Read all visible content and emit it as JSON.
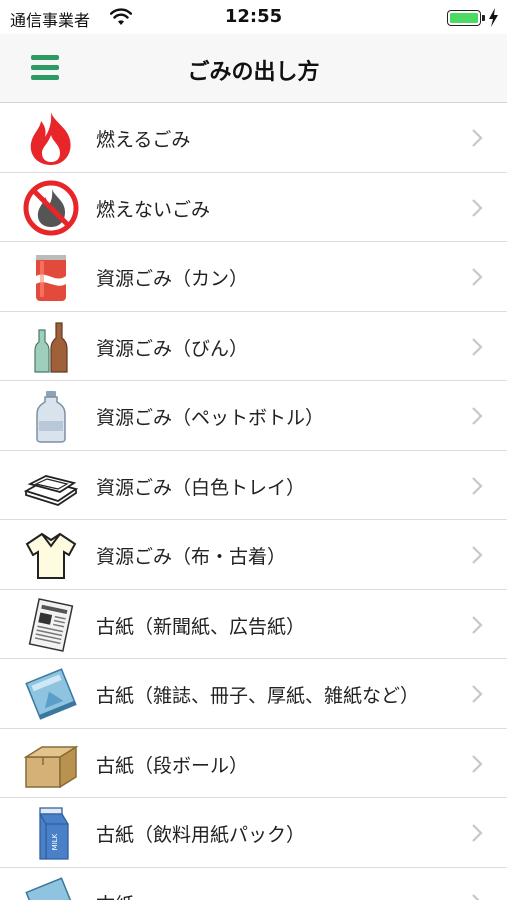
{
  "status": {
    "carrier": "通信事業者",
    "time": "12:55"
  },
  "nav": {
    "title": "ごみの出し方"
  },
  "items": [
    {
      "label": "燃えるごみ",
      "icon": "fire-icon"
    },
    {
      "label": "燃えないごみ",
      "icon": "no-fire-icon"
    },
    {
      "label": "資源ごみ（カン）",
      "icon": "can-icon"
    },
    {
      "label": "資源ごみ（びん）",
      "icon": "bottle-icon"
    },
    {
      "label": "資源ごみ（ペットボトル）",
      "icon": "pet-bottle-icon"
    },
    {
      "label": "資源ごみ（白色トレイ）",
      "icon": "tray-icon"
    },
    {
      "label": "資源ごみ（布・古着）",
      "icon": "shirt-icon"
    },
    {
      "label": "古紙（新聞紙、広告紙）",
      "icon": "newspaper-icon"
    },
    {
      "label": "古紙（雑誌、冊子、厚紙、雑紙など）",
      "icon": "magazine-icon"
    },
    {
      "label": "古紙（段ボール）",
      "icon": "cardboard-box-icon"
    },
    {
      "label": "古紙（飲料用紙パック）",
      "icon": "milk-carton-icon"
    },
    {
      "label": "古紙",
      "icon": "paper-icon"
    }
  ],
  "colors": {
    "accent": "#2e9a63",
    "battery": "#4cd964"
  }
}
